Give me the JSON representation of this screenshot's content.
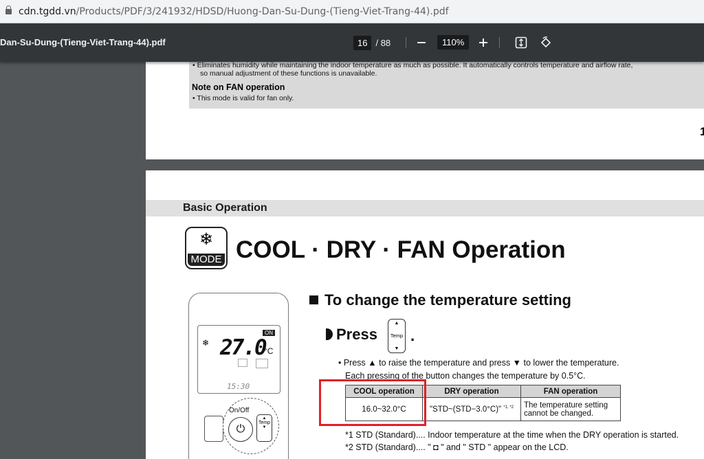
{
  "address_bar": {
    "host": "cdn.tgdd.vn",
    "path": "/Products/PDF/3/241932/HDSD/Huong-Dan-Su-Dung-(Tieng-Viet-Trang-44).pdf"
  },
  "toolbar": {
    "filename": "Dan-Su-Dung-(Tieng-Viet-Trang-44).pdf",
    "page_current": "16",
    "page_total": "/ 88",
    "zoom": "110%",
    "icons": [
      "zoom-out-icon",
      "zoom-in-icon",
      "fit-page-icon",
      "rotate-icon"
    ]
  },
  "page1": {
    "line1": "• Eliminates humidity while maintaining the indoor temperature as much as possible. It automatically controls temperature and airflow rate,",
    "line2": "so manual adjustment of these functions is unavailable.",
    "note_heading": "Note on FAN operation",
    "note_line": "• This mode is valid for fan only.",
    "page_number": "1"
  },
  "page2": {
    "section": "Basic Operation",
    "mode_label": "MODE",
    "title": "COOL · DRY · FAN Operation",
    "remote": {
      "on_badge": "ON",
      "temp": "27.0",
      "unit": "°C",
      "clock": "15:30",
      "onoff_label": "On/Off",
      "temp_label": "Temp"
    },
    "subheading": "To change the temperature setting",
    "press": "Press",
    "temp_key": "Temp",
    "bullet1": "• Press ▲ to raise the temperature and press ▼ to lower the temperature.",
    "bullet2": "Each pressing of the button changes the temperature by 0.5°C.",
    "table": {
      "headers": [
        "COOL operation",
        "DRY operation",
        "FAN operation"
      ],
      "cells": [
        "16.0~32.0°C",
        "\"STD~(STD−3.0°C)\"",
        "The temperature setting cannot be changed."
      ],
      "dry_sup": "*1, *2"
    },
    "footnote1": "*1 STD (Standard).... Indoor temperature at the time when the DRY operation is started.",
    "footnote2": "*2 STD (Standard).... \" ◘ \" and \" STD \" appear on the LCD."
  }
}
